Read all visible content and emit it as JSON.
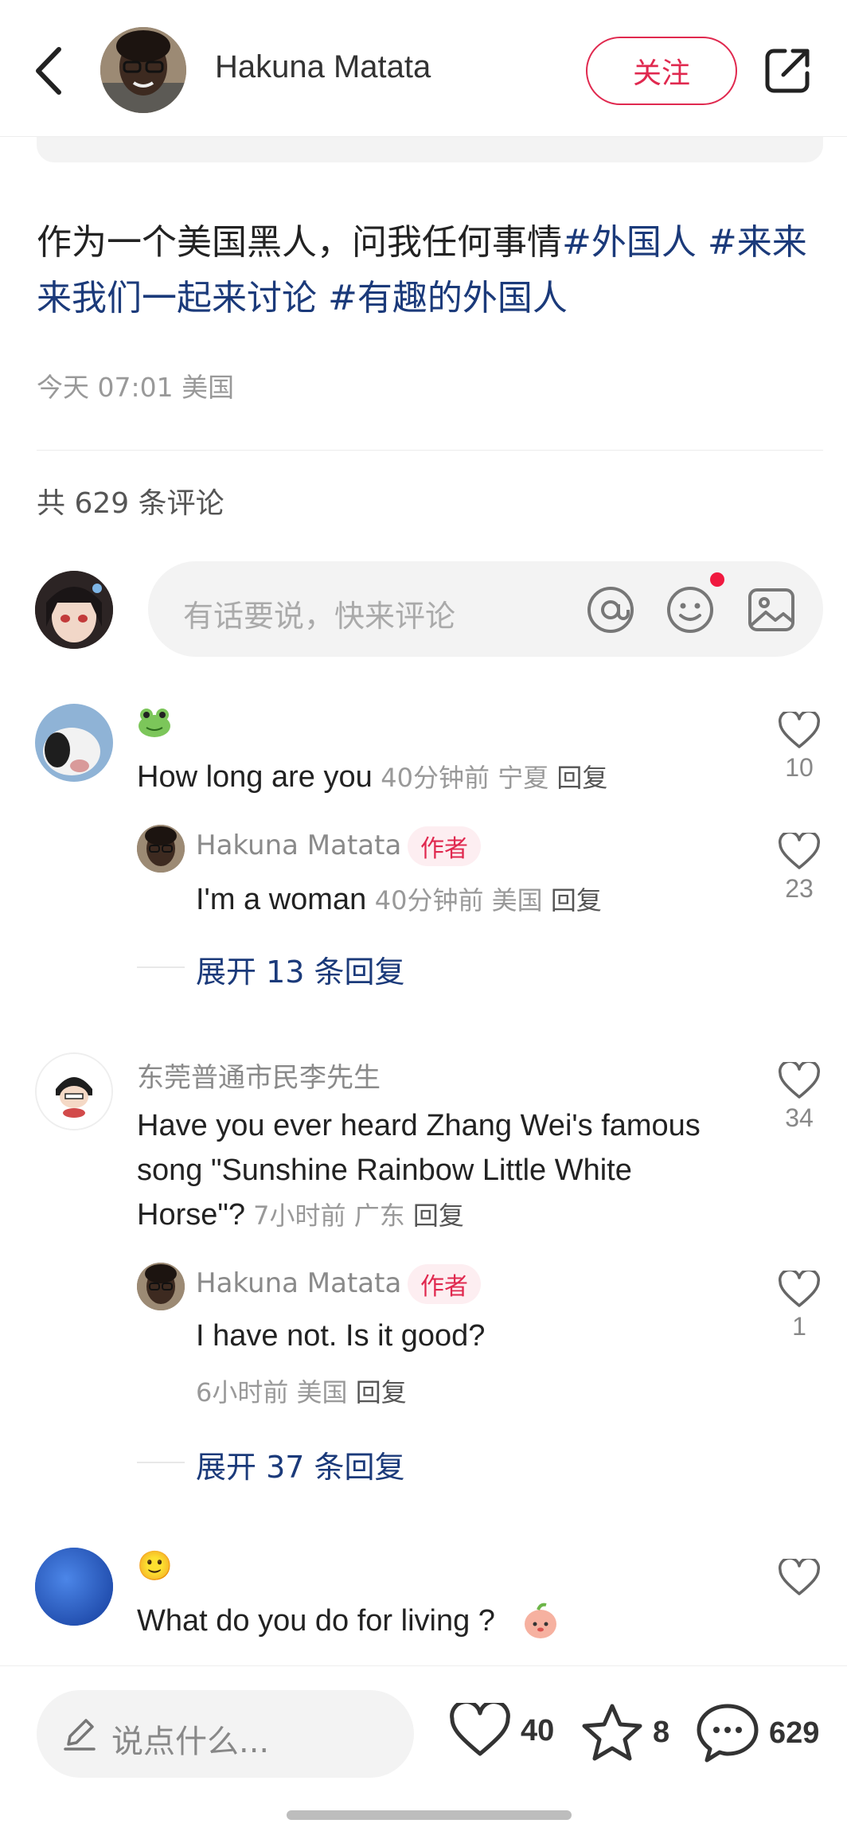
{
  "header": {
    "author_name": "Hakuna Matata",
    "follow_label": "关注"
  },
  "post": {
    "text_segments": [
      {
        "text": "作为一个美国黑人，问我任何事情",
        "tag": false
      },
      {
        "text": "#外国人 #来来来我们一起来讨论 #有趣的外国人",
        "tag": true
      }
    ],
    "plain": "作为一个美国黑人，问我任何事情",
    "tags": "#外国人 #来来来我们一起来讨论 #有趣的外国人",
    "meta": "今天 07:01 美国"
  },
  "comments_header": {
    "count_text": "共 629 条评论"
  },
  "comment_input": {
    "placeholder": "有话要说，快来评论"
  },
  "comments": [
    {
      "name": "🐸",
      "text": "How long are you",
      "meta": "40分钟前  宁夏 ",
      "reply_label": "回复",
      "likes": "10",
      "replies": [
        {
          "name": "Hakuna Matata",
          "badge": "作者",
          "text": "I'm a woman",
          "meta": "40分钟前  美国 ",
          "reply_label": "回复",
          "likes": "23"
        }
      ],
      "expand_label": "展开 13 条回复"
    },
    {
      "name": "东莞普通市民李先生",
      "text_lines": [
        "Have you ever heard Zhang Wei's famous",
        "song \"Sunshine Rainbow Little White",
        "Horse\"?"
      ],
      "meta": "7小时前  广东 ",
      "reply_label": "回复",
      "likes": "34",
      "replies": [
        {
          "name": "Hakuna Matata",
          "badge": "作者",
          "text": "I have not. Is it good?",
          "meta": "6小时前  美国 ",
          "reply_label": "回复",
          "likes": "1"
        }
      ],
      "expand_label": "展开 37 条回复"
    },
    {
      "name": "🙂",
      "text": "What do you do for living ?",
      "likes": ""
    }
  ],
  "bottom_bar": {
    "say_placeholder": "说点什么...",
    "likes": "40",
    "stars": "8",
    "comments": "629"
  },
  "colors": {
    "accent": "#e0294f",
    "tag_blue": "#1b3a7a",
    "muted": "#999999"
  },
  "icons": [
    "back-icon",
    "share-icon",
    "at-icon",
    "emoji-icon",
    "image-icon",
    "heart-icon",
    "star-icon",
    "chat-icon",
    "pencil-icon"
  ]
}
